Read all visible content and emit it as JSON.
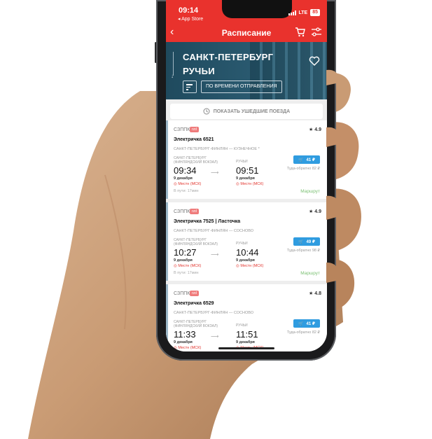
{
  "status_bar": {
    "time": "09:14",
    "back_app": "◂ App Store",
    "network": "LTE",
    "battery": "85"
  },
  "header": {
    "title": "Расписание",
    "back_icon": "back-arrow-icon",
    "cart_icon": "cart-icon",
    "filter_icon": "filter-icon"
  },
  "route": {
    "from": "САНКТ-ПЕТЕРБУРГ",
    "to": "РУЧЬИ",
    "sort_label": "ПО ВРЕМЕНИ ОТПРАВЛЕНИЯ"
  },
  "show_past_label": "ПОКАЗАТЬ УШЕДШИЕ ПОЕЗДА",
  "trains": [
    {
      "carrier": "СЗППК",
      "badge": "rzd",
      "rating": "4.9",
      "name": "Электричка 6521",
      "line": "САНКТ-ПЕТЕРБУРГ-ФИНЛЯН — КУЗНЕЧНОЕ *",
      "from_station": "САНКТ-ПЕТЕРБУРГ (ФИНЛЯНДСКИЙ ВОКЗАЛ)",
      "to_station": "РУЧЬИ",
      "dep_time": "09:34",
      "arr_time": "09:51",
      "dep_date": "9 декабря",
      "arr_date": "9 декабря",
      "dep_seats": "Местн (МСК)",
      "arr_seats": "Местн (МСК)",
      "price": "41 ₽",
      "roundtrip": "Туда-обратно 82 ₽",
      "travel_time": "В пути: 17мин",
      "route_link": "Маршрут"
    },
    {
      "carrier": "СЗППК",
      "badge": "rzd",
      "rating": "4.9",
      "name": "Электричка 7525 | Ласточка",
      "line": "САНКТ-ПЕТЕРБУРГ-ФИНЛЯН — СОСНОВО",
      "from_station": "САНКТ-ПЕТЕРБУРГ (ФИНЛЯНДСКИЙ ВОКЗАЛ)",
      "to_station": "РУЧЬИ",
      "dep_time": "10:27",
      "arr_time": "10:44",
      "dep_date": "9 декабря",
      "arr_date": "9 декабря",
      "dep_seats": "Местн (МСК)",
      "arr_seats": "Местн (МСК)",
      "price": "49 ₽",
      "roundtrip": "Туда-обратно 98 ₽",
      "travel_time": "В пути: 17мин",
      "route_link": "Маршрут"
    },
    {
      "carrier": "СЗППК",
      "badge": "rzd",
      "rating": "4.8",
      "name": "Электричка 6529",
      "line": "САНКТ-ПЕТЕРБУРГ-ФИНЛЯН — СОСНОВО",
      "from_station": "САНКТ-ПЕТЕРБУРГ (ФИНЛЯНДСКИЙ ВОКЗАЛ)",
      "to_station": "РУЧЬИ",
      "dep_time": "11:33",
      "arr_time": "11:51",
      "dep_date": "9 декабря",
      "arr_date": "9 декабря",
      "dep_seats": "Местн (МСК)",
      "arr_seats": "Местн (МСК)",
      "price": "41 ₽",
      "roundtrip": "Туда-обратно 82 ₽",
      "travel_time": "",
      "route_link": ""
    }
  ],
  "colors": {
    "accent": "#e9322d",
    "banner": "#1f4a5e",
    "price_button": "#2f9ce0",
    "route_link": "#7cc174",
    "seats": "#e2342d"
  }
}
